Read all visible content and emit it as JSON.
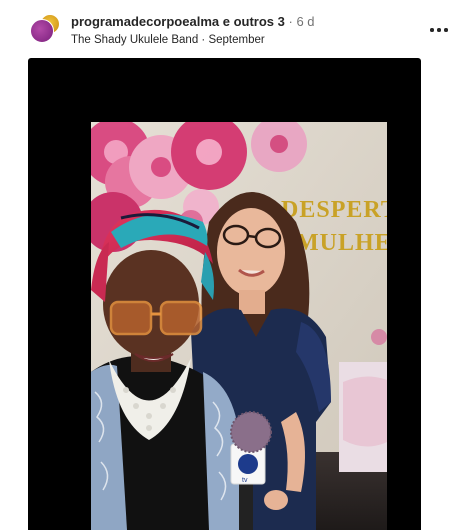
{
  "post": {
    "author": "programadecorpoealma",
    "collaborators": "e outros 3",
    "separator": "·",
    "age": "6 d",
    "song": "The Shady Ukulele Band",
    "song_separator": "·",
    "date": "September",
    "more_icon": "more-horizontal-icon"
  },
  "photo": {
    "wall_sign_lines": [
      "DESPERTE",
      "MULHER"
    ],
    "microphone_flag_label": "tv"
  },
  "colors": {
    "text_primary": "#262626",
    "text_secondary": "#737373",
    "media_background": "#000000",
    "avatar_primary": "#8a2c88",
    "avatar_secondary": "#e0a92a"
  }
}
